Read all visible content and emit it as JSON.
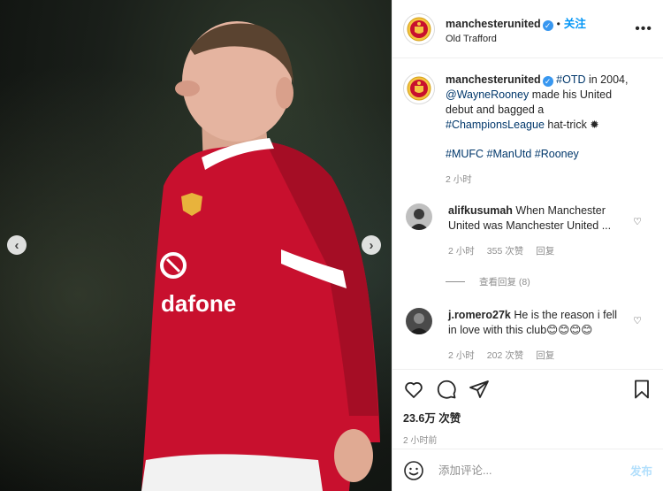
{
  "post": {
    "username": "manchesterunited",
    "follow_label": "关注",
    "location": "Old Trafford",
    "more_icon": "more-horizontal-icon",
    "photo_text": "dafone"
  },
  "caption": {
    "username": "manchesterunited",
    "hashtag_otd": "#OTD",
    "text_1": " in 2004,",
    "mention": "@WayneRooney",
    "text_2": " made his United debut and bagged a ",
    "hashtag_cl": "#ChampionsLeague",
    "text_3": " hat-trick ✹",
    "hashtags": [
      "#MUFC",
      "#ManUtd",
      "#Rooney"
    ],
    "time": "2 小时"
  },
  "comments": [
    {
      "username": "alifkusumah",
      "text": "When Manchester United was Manchester United ...",
      "time": "2 小时",
      "likes": "355 次赞",
      "reply": "回复",
      "view_replies": "查看回复 (8)"
    },
    {
      "username": "j.romero27k",
      "text": "He is the reason i fell in love with this club😊😊😊😊",
      "time": "2 小时",
      "likes": "202 次赞",
      "reply": "回复"
    }
  ],
  "stats": {
    "likes": "23.6万 次赞",
    "posted": "2 小时前"
  },
  "comment_box": {
    "placeholder": "添加评论...",
    "post_label": "发布"
  },
  "colors": {
    "link": "#00376b",
    "accent": "#0095f6",
    "verified": "#3897f0",
    "muted": "#8e8e8e",
    "jersey": "#c8102e"
  }
}
